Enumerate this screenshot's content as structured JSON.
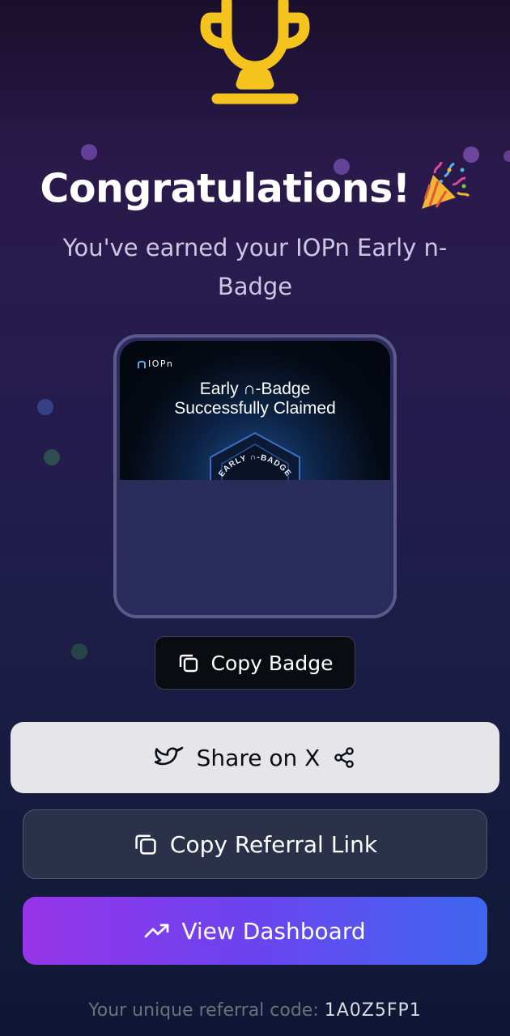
{
  "colors": {
    "trophy": "#f5c31e",
    "background_top": "#1a0f2c",
    "background_bottom": "#101634",
    "share_button": "#e6e6ea",
    "referral_button": "#2a3149",
    "dashboard_gradient_start": "#9634e8",
    "dashboard_gradient_end": "#3f67ef",
    "referral_code": "#d9dbe6"
  },
  "header": {
    "icon": "trophy-icon",
    "title": "Congratulations!",
    "title_emoji": "party-popper-icon",
    "subtitle": "You've earned your IOPn Early n-Badge"
  },
  "badge": {
    "logo_text": "IOPn",
    "headline_line1": "Early ∩-Badge",
    "headline_line2": "Successfully Claimed",
    "emblem_text": "EARLY ∩-BADGE"
  },
  "actions": {
    "copy_badge": {
      "label": "Copy Badge",
      "icon": "copy-icon"
    },
    "share_x": {
      "label": "Share on X",
      "icon": "twitter-bird-icon",
      "trailing_icon": "share-icon"
    },
    "copy_referral": {
      "label": "Copy Referral Link",
      "icon": "copy-icon"
    },
    "dashboard": {
      "label": "View Dashboard",
      "icon": "trending-up-icon"
    }
  },
  "referral": {
    "label": "Your unique referral code:",
    "code": "1A0Z5FP1"
  }
}
